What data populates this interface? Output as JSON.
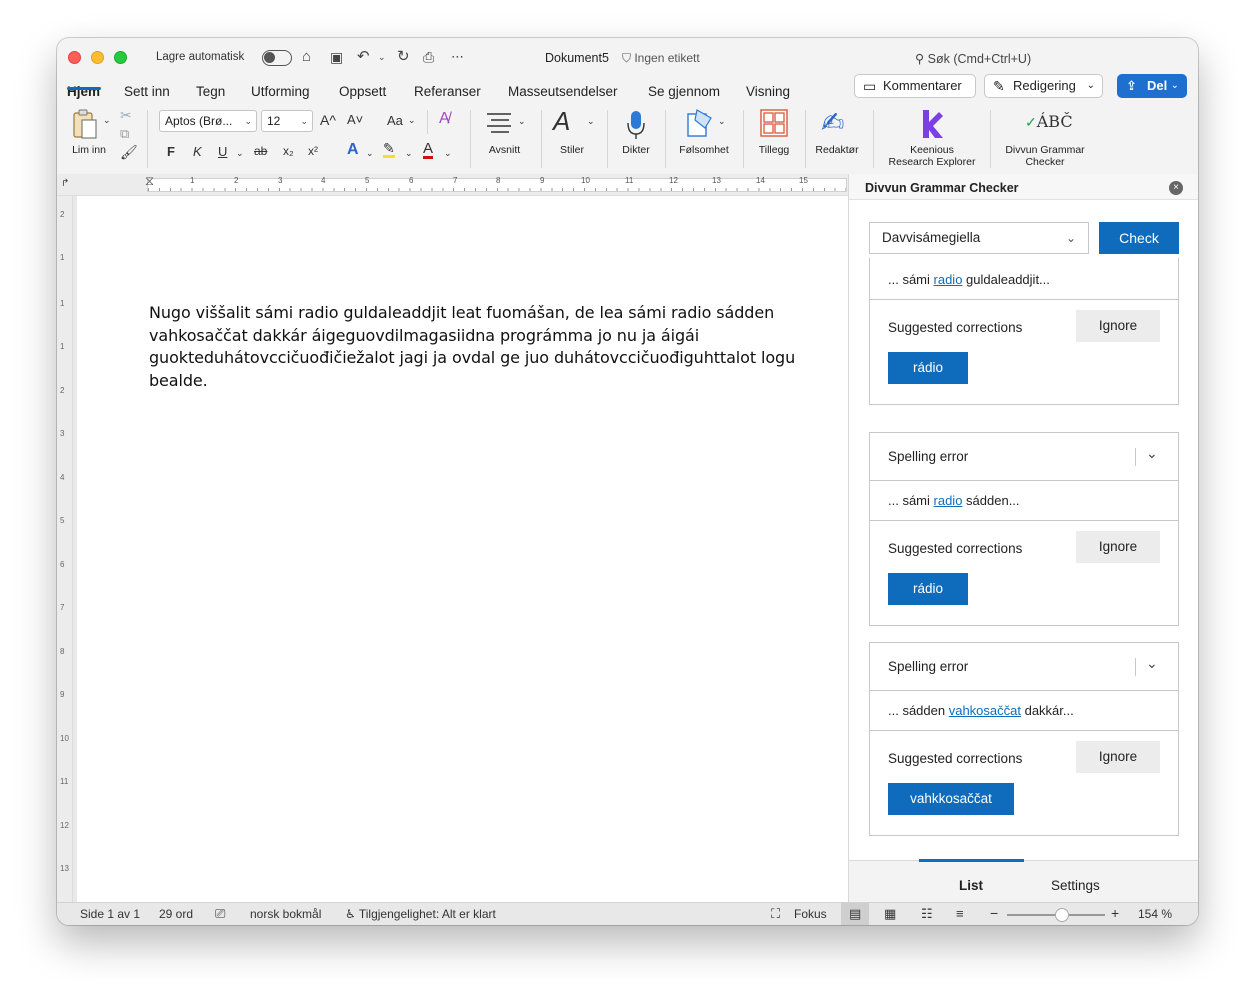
{
  "titlebar": {
    "autosave_label": "Lagre automatisk",
    "document_title": "Dokument5",
    "sensitivity_label": "Ingen etikett",
    "search_placeholder": "Søk (Cmd+Ctrl+U)"
  },
  "menu": {
    "tabs": [
      {
        "label": "Hjem",
        "active": true
      },
      {
        "label": "Sett inn"
      },
      {
        "label": "Tegn"
      },
      {
        "label": "Utforming"
      },
      {
        "label": "Oppsett"
      },
      {
        "label": "Referanser"
      },
      {
        "label": "Masseutsendelser"
      },
      {
        "label": "Se gjennom"
      },
      {
        "label": "Visning"
      }
    ],
    "comments_label": "Kommentarer",
    "editing_label": "Redigering",
    "share_label": "Del"
  },
  "ribbon": {
    "paste_label": "Lim inn",
    "font_name": "Aptos (Brø...",
    "font_size": "12",
    "grow_glyph": "A^",
    "shrink_glyph": "A˅",
    "case_glyph": "Aa",
    "bold_glyph": "F",
    "italic_glyph": "K",
    "underline_glyph": "U",
    "strike_glyph": "ab",
    "subscript_glyph": "x₂",
    "superscript_glyph": "x²",
    "paragraph_label": "Avsnitt",
    "styles_label": "Stiler",
    "dictate_label": "Dikter",
    "sensitivity_label": "Følsomhet",
    "addins_label": "Tillegg",
    "editor_label": "Redaktør",
    "keenious_label_1": "Keenious",
    "keenious_label_2": "Research Explorer",
    "divvun_label_1": "Divvun Grammar",
    "divvun_label_2": "Checker",
    "divvun_icon_text": "ÁBČ"
  },
  "ruler": {
    "h_numbers": [
      "1",
      "2",
      "3",
      "4",
      "5",
      "6",
      "7",
      "8",
      "9",
      "10",
      "11",
      "12",
      "13",
      "14",
      "15"
    ],
    "v_numbers": [
      "2",
      "1",
      "1",
      "1",
      "2",
      "3",
      "4",
      "5",
      "6",
      "7",
      "8",
      "9",
      "10",
      "11",
      "12",
      "13"
    ]
  },
  "document": {
    "paragraph": "Nugo viššalit sámi radio guldaleaddjit leat fuomášan, de lea sámi radio sádden vahkosaččat dakkár áigeguovdilmagasiidna prográmma jo nu ja áigái guokteduhátovccičuođičiežalot jagi ja ovdal ge juo duhátovccičuođiguhttalot logu bealde."
  },
  "pane": {
    "title": "Divvun Grammar Checker",
    "language": "Davvisámegiella",
    "check_label": "Check",
    "cards": [
      {
        "error_type": "",
        "context_before": "... sámi ",
        "context_word": "radio",
        "context_after": " guldaleaddjit...",
        "suggestions_label": "Suggested corrections",
        "ignore_label": "Ignore",
        "fix": "rádio"
      },
      {
        "error_type": "Spelling error",
        "context_before": "... sámi ",
        "context_word": "radio",
        "context_after": " sádden...",
        "suggestions_label": "Suggested corrections",
        "ignore_label": "Ignore",
        "fix": "rádio"
      },
      {
        "error_type": "Spelling error",
        "context_before": "... sádden ",
        "context_word": "vahkosaččat",
        "context_after": " dakkár...",
        "suggestions_label": "Suggested corrections",
        "ignore_label": "Ignore",
        "fix": "vahkkosaččat"
      }
    ],
    "tabs": [
      {
        "label": "List",
        "active": true
      },
      {
        "label": "Settings"
      }
    ]
  },
  "status": {
    "page": "Side 1 av 1",
    "words": "29 ord",
    "language": "norsk bokmål",
    "accessibility": "Tilgjengelighet: Alt er klart",
    "focus": "Fokus",
    "zoom": "154 %"
  },
  "colors": {
    "accent": "#0f6cbd",
    "share": "#1f6fd0",
    "keenious": "#7b3fe4"
  }
}
